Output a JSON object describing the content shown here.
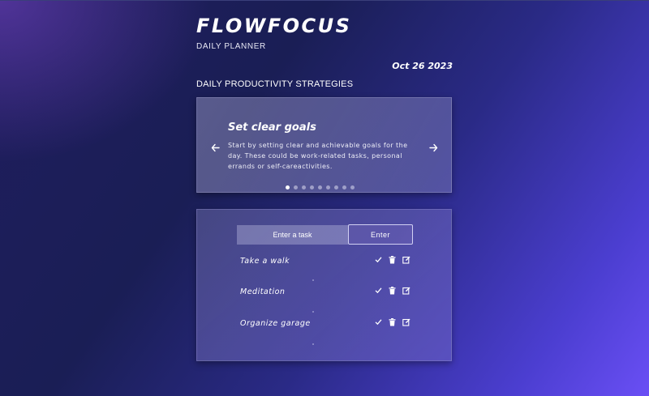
{
  "header": {
    "app_title": "FLOWFOCUS",
    "subtitle": "DAILY PLANNER",
    "date": "Oct 26 2023"
  },
  "strategies": {
    "heading": "DAILY PRODUCTIVITY STRATEGIES",
    "current_slide": {
      "title": "Set clear goals",
      "text": "Start by setting clear and achievable goals for the day. These could be work-related tasks, personal errands or self-careactivities."
    },
    "slide_count": 9,
    "active_slide_index": 0,
    "prev_icon": "arrow-left-icon",
    "next_icon": "arrow-right-icon"
  },
  "tasks": {
    "input_placeholder": "Enter a task",
    "input_value": "",
    "enter_label": "Enter",
    "items": [
      {
        "label": "Take a walk"
      },
      {
        "label": "Meditation"
      },
      {
        "label": "Organize garage"
      }
    ],
    "item_actions": [
      "check-icon",
      "trash-icon",
      "edit-icon"
    ]
  },
  "colors": {
    "background_start": "#1f1d5e",
    "background_end": "#6a4ff5",
    "text": "#ffffff"
  }
}
